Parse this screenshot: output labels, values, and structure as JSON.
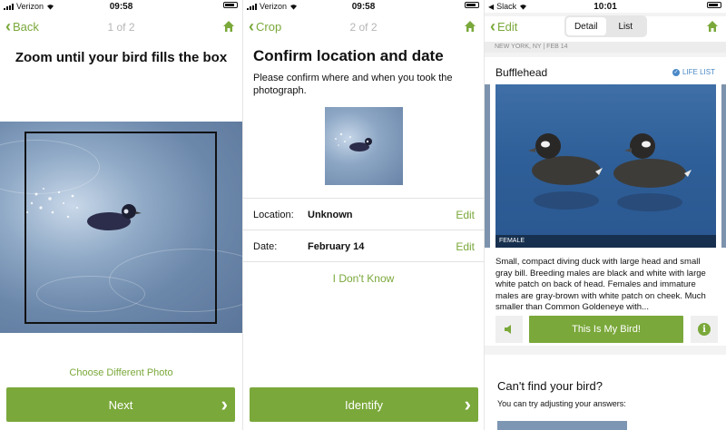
{
  "screen1": {
    "status": {
      "carrier": "Verizon",
      "time": "09:58"
    },
    "nav": {
      "back_label": "Back",
      "counter": "1 of 2"
    },
    "title": "Zoom until your bird fills the box",
    "change_photo_link": "Choose Different Photo",
    "next_button": "Next"
  },
  "screen2": {
    "status": {
      "carrier": "Verizon",
      "time": "09:58"
    },
    "nav": {
      "back_label": "Crop",
      "counter": "2 of 2"
    },
    "title": "Confirm location and date",
    "subtitle": "Please confirm where and when you took the photograph.",
    "location": {
      "label": "Location:",
      "value": "Unknown",
      "edit": "Edit"
    },
    "date": {
      "label": "Date:",
      "value": "February 14",
      "edit": "Edit"
    },
    "dont_know": "I Don't Know",
    "identify_button": "Identify"
  },
  "screen3": {
    "status": {
      "carrier": "Slack",
      "time": "10:01"
    },
    "nav": {
      "back_label": "Edit"
    },
    "segments": [
      "Detail",
      "List"
    ],
    "active_segment": "Detail",
    "meta": "NEW YORK, NY  |  FEB 14",
    "species": "Bufflehead",
    "life_list": "LIFE LIST",
    "photo_label": "FEMALE",
    "description": "Small, compact diving duck with large head and small gray bill. Breeding males are black and white with large white patch on back of head. Females and immature males are gray-brown with white patch on cheek. Much smaller than Common Goldeneye with...",
    "my_bird_button": "This Is My Bird!",
    "info_glyph": "i",
    "cant_find_title": "Can't find your bird?",
    "cant_find_text": "You can try adjusting your answers:"
  },
  "colors": {
    "accent_green": "#7aa83a",
    "life_list_blue": "#4a88c7"
  }
}
